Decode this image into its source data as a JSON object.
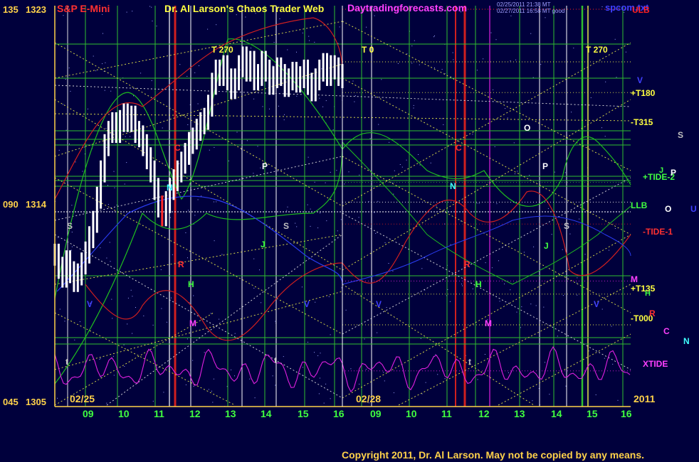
{
  "header": {
    "instrument": "S&P E-Mini",
    "site_title": "Dr. Al Larson's Chaos Trader Web",
    "site_url": "Daytradingforecasts.com",
    "stamp_line1": "02/25/2011 21:38 MT",
    "stamp_line2": "02/27/2011 16:58 MT good",
    "file_name": "spcom.txt"
  },
  "footer": {
    "copyright": "Copyright 2011, Dr. Al Larson. May not be copied by any means."
  },
  "colors": {
    "background": "#00003c",
    "axis_gold": "#ffd24a",
    "price_bar": "#ffffff",
    "price_bar_down": "#ff2a2a",
    "grid_green": "#2fbf2f",
    "fan_yellow": "#e8e84a",
    "fan_white": "#e0e0e0",
    "curve_green": "#1fbf1f",
    "curve_red": "#d01f1f",
    "curve_blue": "#2a3cf0",
    "curve_magenta": "#e020e0",
    "title_red": "#ff3030",
    "title_yellow": "#ffff40",
    "title_magenta": "#ff40ff"
  },
  "chart_data": {
    "type": "bar",
    "title": "S&P E-Mini",
    "y_left_labels": [
      {
        "label": "135",
        "price": 1323
      },
      {
        "label": "090",
        "price": 1314
      },
      {
        "label": "045",
        "price": 1305
      }
    ],
    "y_price_labels": [
      "1323",
      "1314",
      "1305"
    ],
    "ylim": [
      1305,
      1323
    ],
    "date_labels": [
      "02/25",
      "02/28"
    ],
    "year_label": "2011",
    "sessions": [
      {
        "date": "02/25",
        "hours": [
          "09",
          "10",
          "11",
          "12",
          "13",
          "14",
          "15",
          "16"
        ]
      },
      {
        "date": "02/28",
        "hours": [
          "09",
          "10",
          "11",
          "12",
          "13",
          "14",
          "15",
          "16"
        ]
      }
    ],
    "transit_markers": [
      "T 270",
      "T 0",
      "T 270"
    ],
    "right_levels": [
      {
        "label": "ULB",
        "price": 1323
      },
      {
        "label": "+T180",
        "price": 1320.6
      },
      {
        "label": "-T315",
        "price": 1319.2
      },
      {
        "label": "+TIDE-2",
        "price": 1315.1
      },
      {
        "label": "LLB",
        "price": 1314.2
      },
      {
        "label": "-TIDE-1",
        "price": 1313.2
      },
      {
        "label": "M",
        "price": 1310.6
      },
      {
        "label": "+T135",
        "price": 1310.0
      },
      {
        "label": "-T000",
        "price": 1308.6
      },
      {
        "label": "XTIDE",
        "price": 1306.5
      }
    ],
    "right_planets": [
      "V",
      "S",
      "J",
      "P",
      "O",
      "U",
      "H",
      "R",
      "C",
      "N"
    ],
    "session1_markers": [
      "S",
      "C",
      "N",
      "R",
      "H",
      "M",
      "J",
      "P",
      "S",
      "t",
      "t",
      "V",
      "V"
    ],
    "session2_markers": [
      "C",
      "N",
      "R",
      "H",
      "M",
      "O",
      "P",
      "J",
      "S",
      "t",
      "V",
      "V"
    ],
    "price_series": {
      "name": "",
      "hours": [
        8.5,
        8.6,
        8.7,
        8.8,
        8.9,
        9.0,
        9.1,
        9.2,
        9.3,
        9.4,
        9.5,
        9.6,
        9.7,
        9.8,
        9.9,
        10.0,
        10.1,
        10.2,
        10.3,
        10.4,
        10.5,
        10.6,
        10.7,
        10.8,
        10.9,
        11.0,
        11.1,
        11.2,
        11.3,
        11.4,
        11.5,
        11.6,
        11.7,
        11.8,
        11.9,
        12.0,
        12.1,
        12.2,
        12.3,
        12.4,
        12.5,
        12.6,
        12.7,
        12.8,
        12.9,
        13.0,
        13.1,
        13.2,
        13.3,
        13.4,
        13.5,
        13.6,
        13.7,
        13.8,
        13.9,
        14.0,
        14.1,
        14.2,
        14.3,
        14.4,
        14.5,
        14.6,
        14.7,
        14.8,
        14.9,
        15.0,
        15.1,
        15.2,
        15.3,
        15.4,
        15.5,
        15.6,
        15.7,
        15.8,
        15.9,
        16.0
      ],
      "close": [
        1311.8,
        1311.2,
        1310.8,
        1311.5,
        1311.0,
        1310.6,
        1310.9,
        1311.4,
        1311.9,
        1312.6,
        1313.3,
        1314.4,
        1315.6,
        1316.8,
        1317.4,
        1317.8,
        1317.4,
        1317.9,
        1318.2,
        1317.9,
        1318.1,
        1317.4,
        1317.2,
        1316.8,
        1316.2,
        1315.6,
        1314.8,
        1314.0,
        1313.6,
        1314.2,
        1314.8,
        1315.2,
        1315.6,
        1316.0,
        1316.4,
        1316.9,
        1317.1,
        1317.5,
        1317.8,
        1318.0,
        1318.6,
        1319.6,
        1320.2,
        1320.0,
        1320.4,
        1319.8,
        1319.4,
        1319.8,
        1320.4,
        1320.8,
        1320.2,
        1320.6,
        1319.8,
        1320.0,
        1320.6,
        1320.2,
        1319.6,
        1319.9,
        1320.3,
        1320.0,
        1319.5,
        1319.8,
        1320.1,
        1319.7,
        1319.9,
        1320.2,
        1319.6,
        1319.3,
        1319.8,
        1320.2,
        1320.5,
        1320.0,
        1320.4,
        1320.3,
        1320.0,
        1319.9
      ]
    }
  }
}
